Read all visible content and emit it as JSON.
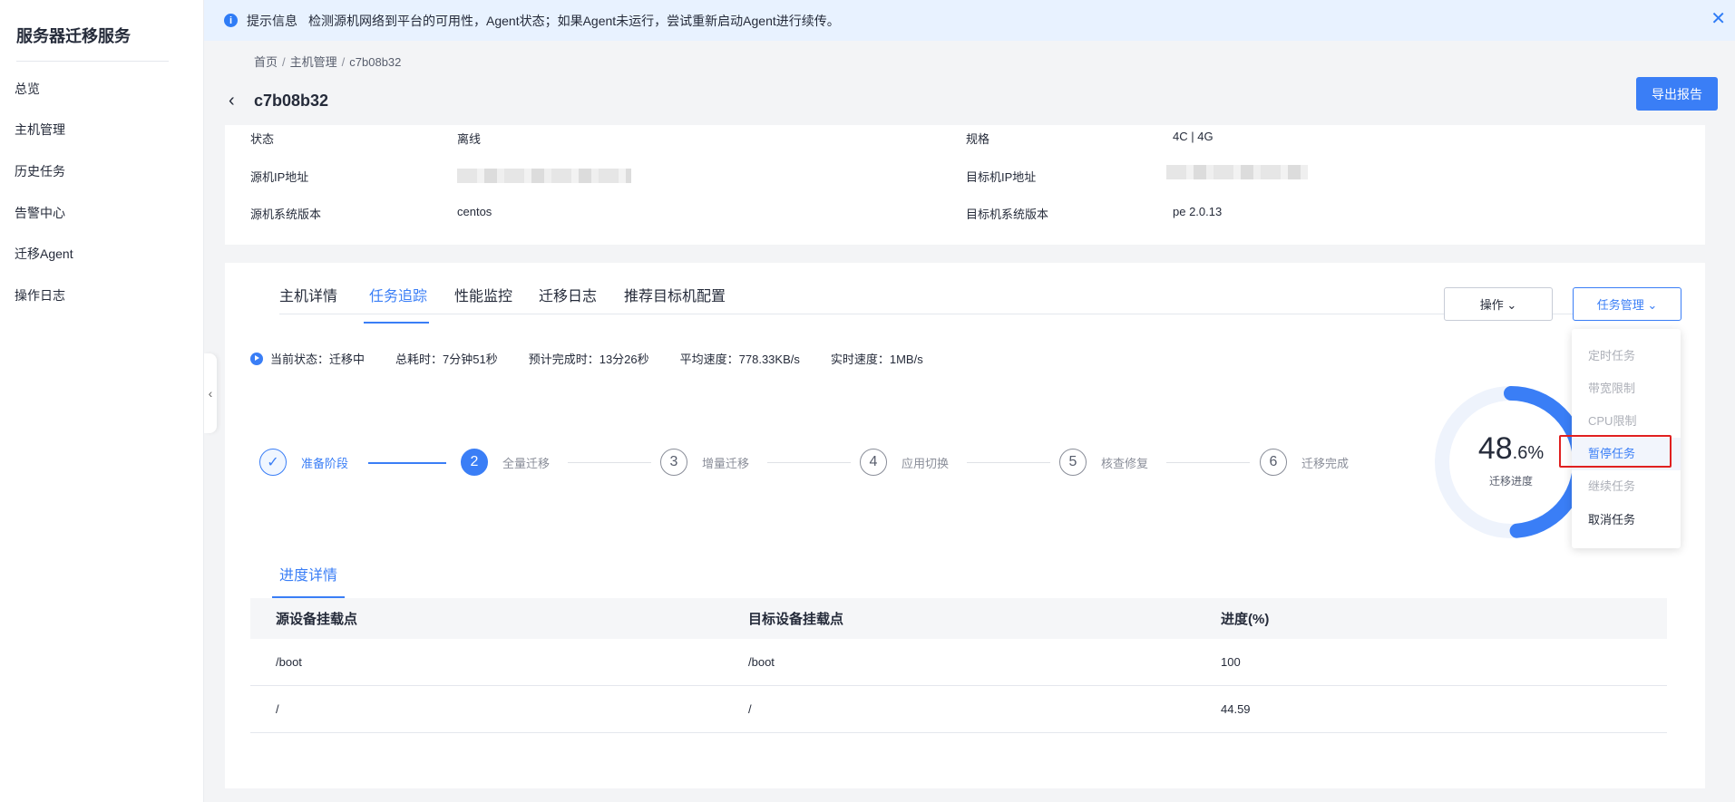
{
  "sidebar": {
    "title": "服务器迁移服务",
    "items": [
      {
        "label": "总览"
      },
      {
        "label": "主机管理"
      },
      {
        "label": "历史任务"
      },
      {
        "label": "告警中心"
      },
      {
        "label": "迁移Agent"
      },
      {
        "label": "操作日志"
      }
    ]
  },
  "notice": {
    "title": "提示信息",
    "text": "检测源机网络到平台的可用性，Agent状态；如果Agent未运行，尝试重新启动Agent进行续传。"
  },
  "breadcrumb": {
    "items": [
      "首页",
      "主机管理",
      "c7b08b32"
    ]
  },
  "header": {
    "title": "c7b08b32",
    "export_label": "导出报告"
  },
  "info": {
    "status_label": "状态",
    "status_value": "离线",
    "source_ip_label": "源机IP地址",
    "source_os_label": "源机系统版本",
    "source_os_value": "centos",
    "spec_label": "规格",
    "spec_value": "4C | 4G",
    "target_ip_label": "目标机IP地址",
    "target_os_label": "目标机系统版本",
    "target_os_value": "pe 2.0.13"
  },
  "tabs": [
    {
      "label": "主机详情"
    },
    {
      "label": "任务追踪",
      "active": true
    },
    {
      "label": "性能监控"
    },
    {
      "label": "迁移日志"
    },
    {
      "label": "推荐目标机配置"
    }
  ],
  "actions": {
    "operate_label": "操作",
    "task_manage_label": "任务管理"
  },
  "status": {
    "current": "当前状态：迁移中",
    "elapsed": "总耗时：7分钟51秒",
    "eta": "预计完成时：13分26秒",
    "avg_speed": "平均速度：778.33KB/s",
    "realtime_speed": "实时速度：1MB/s"
  },
  "steps": [
    {
      "num": "",
      "label": "准备阶段",
      "state": "done"
    },
    {
      "num": "2",
      "label": "全量迁移",
      "state": "current"
    },
    {
      "num": "3",
      "label": "增量迁移",
      "state": "pending"
    },
    {
      "num": "4",
      "label": "应用切换",
      "state": "pending"
    },
    {
      "num": "5",
      "label": "核查修复",
      "state": "pending"
    },
    {
      "num": "6",
      "label": "迁移完成",
      "state": "pending"
    }
  ],
  "progress": {
    "value": 48.6,
    "int_part": "48",
    "dec_part": ".6%",
    "caption": "迁移进度"
  },
  "task_menu": {
    "items": [
      {
        "label": "定时任务",
        "enabled": false
      },
      {
        "label": "带宽限制",
        "enabled": false
      },
      {
        "label": "CPU限制",
        "enabled": false
      },
      {
        "label": "暂停任务",
        "enabled": true,
        "hover": true
      },
      {
        "label": "继续任务",
        "enabled": false
      },
      {
        "label": "取消任务",
        "enabled": true
      }
    ]
  },
  "detail": {
    "tab_label": "进度详情",
    "columns": [
      "源设备挂载点",
      "目标设备挂载点",
      "进度(%)"
    ],
    "rows": [
      [
        "/boot",
        "/boot",
        "100"
      ],
      [
        "/",
        "/",
        "44.59"
      ]
    ]
  },
  "colors": {
    "accent": "#3a7ef6",
    "highlight": "#e02020",
    "notice_bg": "#e8f2ff"
  }
}
